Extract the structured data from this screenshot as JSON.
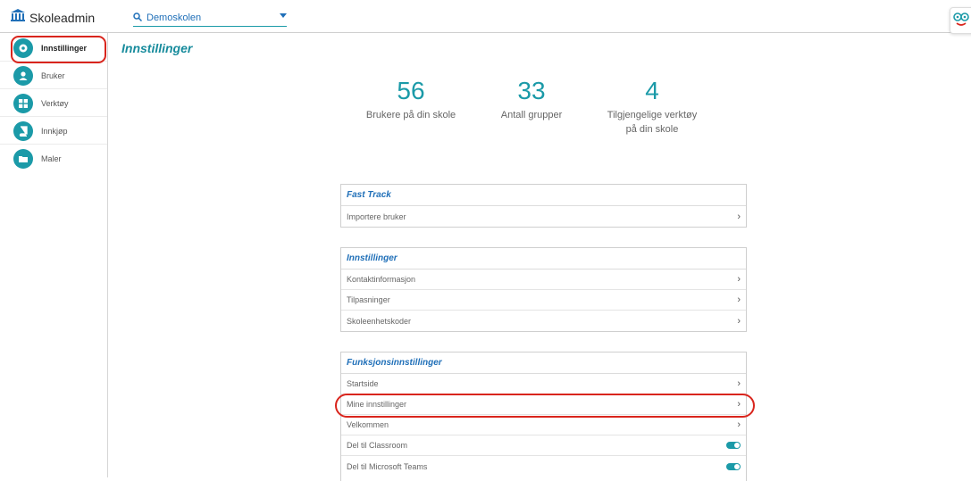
{
  "app": {
    "title": "Skoleadmin"
  },
  "school_select": {
    "value": "Demoskolen"
  },
  "sidebar": {
    "items": [
      {
        "label": "Innstillinger",
        "icon": "gear-icon",
        "active": true
      },
      {
        "label": "Bruker",
        "icon": "user-icon"
      },
      {
        "label": "Verktøy",
        "icon": "grid-icon"
      },
      {
        "label": "Innkjøp",
        "icon": "book-icon"
      },
      {
        "label": "Maler",
        "icon": "folder-icon"
      }
    ]
  },
  "page": {
    "title": "Innstillinger"
  },
  "stats": [
    {
      "value": "56",
      "label": "Brukere på din skole"
    },
    {
      "value": "33",
      "label": "Antall grupper"
    },
    {
      "value": "4",
      "label": "Tilgjengelige verktøy på din skole"
    }
  ],
  "panels": {
    "fast_track": {
      "title": "Fast Track",
      "rows": [
        "Importere bruker"
      ]
    },
    "settings": {
      "title": "Innstillinger",
      "rows": [
        "Kontaktinformasjon",
        "Tilpasninger",
        "Skoleenhetskoder"
      ]
    },
    "functions": {
      "title": "Funksjonsinnstillinger",
      "rows": [
        "Startside",
        "Mine innstillinger",
        "Velkommen",
        "Del til Classroom",
        "Del til Microsoft Teams"
      ]
    }
  },
  "colors": {
    "accent": "#1b9aa8",
    "link": "#1f6fb8",
    "highlight": "#d9251d"
  }
}
